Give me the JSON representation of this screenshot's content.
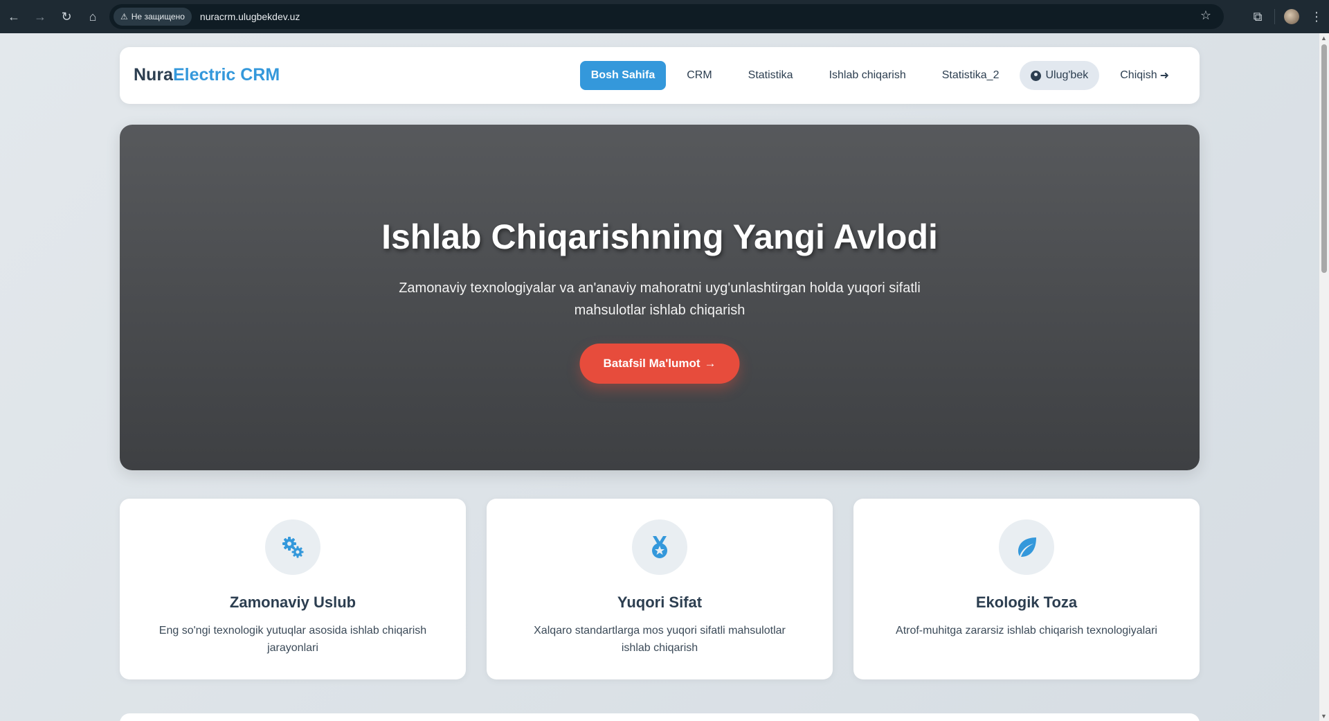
{
  "browser": {
    "security_label": "Не защищено",
    "url": "nuracrm.ulugbekdev.uz"
  },
  "brand": {
    "primary": "Nura",
    "accent": "Electric CRM"
  },
  "nav": {
    "items": [
      {
        "label": "Bosh Sahifa",
        "active": true
      },
      {
        "label": "CRM"
      },
      {
        "label": "Statistika"
      },
      {
        "label": "Ishlab chiqarish"
      },
      {
        "label": "Statistika_2"
      }
    ],
    "user": "Ulug'bek",
    "logout": "Chiqish"
  },
  "hero": {
    "title": "Ishlab Chiqarishning Yangi Avlodi",
    "subtitle": "Zamonaviy texnologiyalar va an'anaviy mahoratni uyg'unlashtirgan holda yuqori sifatli mahsulotlar ishlab chiqarish",
    "cta": "Batafsil Ma'lumot"
  },
  "features": [
    {
      "icon": "gears-icon",
      "title": "Zamonaviy Uslub",
      "desc": "Eng so'ngi texnologik yutuqlar asosida ishlab chiqarish jarayonlari"
    },
    {
      "icon": "medal-icon",
      "title": "Yuqori Sifat",
      "desc": "Xalqaro standartlarga mos yuqori sifatli mahsulotlar ishlab chiqarish"
    },
    {
      "icon": "leaf-icon",
      "title": "Ekologik Toza",
      "desc": "Atrof-muhitga zararsiz ishlab chiqarish texnologiyalari"
    }
  ],
  "colors": {
    "accent": "#3498db",
    "cta": "#e74c3c",
    "text_dark": "#2c3e50"
  }
}
